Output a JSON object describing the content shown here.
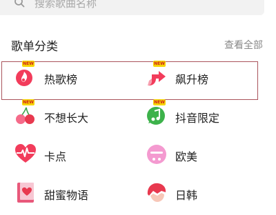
{
  "search": {
    "placeholder": "搜索歌曲名称"
  },
  "section": {
    "title": "歌单分类",
    "view_all": "查看全部"
  },
  "categories": [
    {
      "label": "热歌榜",
      "icon": "hot-songs-icon",
      "new": true
    },
    {
      "label": "飙升榜",
      "icon": "rising-chart-icon",
      "new": true
    },
    {
      "label": "不想长大",
      "icon": "cherries-icon",
      "new": true
    },
    {
      "label": "抖音限定",
      "icon": "music-bubble-icon",
      "new": true
    },
    {
      "label": "卡点",
      "icon": "heartbeat-icon",
      "new": false
    },
    {
      "label": "欧美",
      "icon": "pink-face-icon",
      "new": false
    },
    {
      "label": "甜蜜物语",
      "icon": "love-book-icon",
      "new": false
    },
    {
      "label": "日韩",
      "icon": "red-hair-icon",
      "new": false
    }
  ],
  "badge": {
    "text": "NEW"
  },
  "colors": {
    "accent_red": "#f23c5b",
    "badge_yellow": "#f6d500",
    "highlight_border": "#a9525a"
  }
}
